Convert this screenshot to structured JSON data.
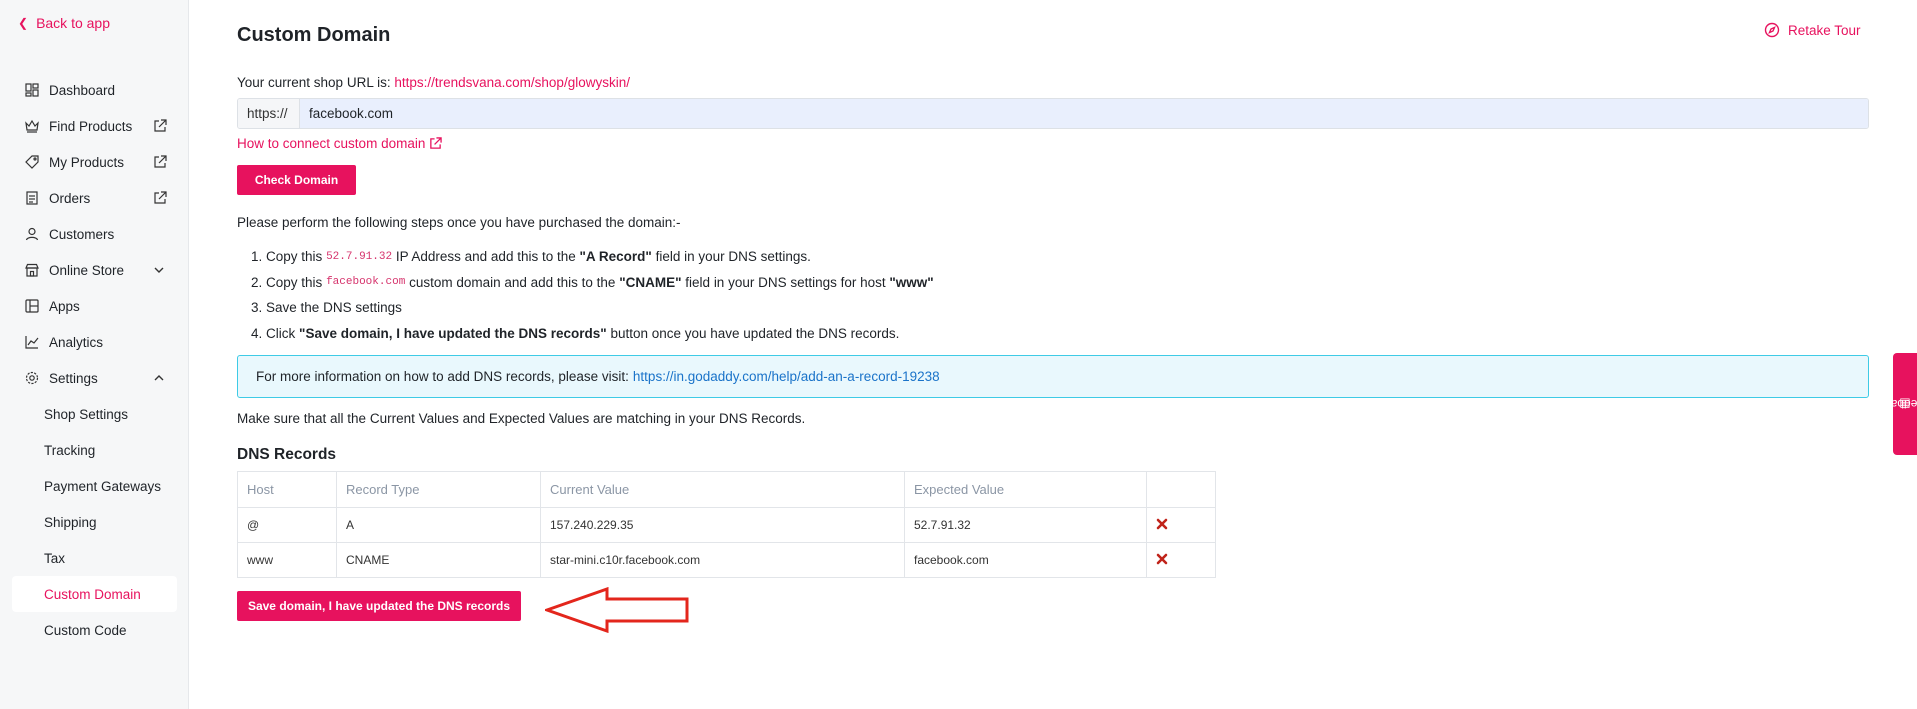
{
  "sidebar": {
    "back_label": "Back to app",
    "items": [
      {
        "label": "Dashboard",
        "icon": "dashboard-icon"
      },
      {
        "label": "Find Products",
        "icon": "crown-icon",
        "external": true
      },
      {
        "label": "My Products",
        "icon": "tag-icon",
        "external": true
      },
      {
        "label": "Orders",
        "icon": "document-icon",
        "external": true
      },
      {
        "label": "Customers",
        "icon": "user-icon"
      },
      {
        "label": "Online Store",
        "icon": "store-icon",
        "expandable": true
      },
      {
        "label": "Apps",
        "icon": "apps-icon"
      },
      {
        "label": "Analytics",
        "icon": "chart-icon"
      },
      {
        "label": "Settings",
        "icon": "gear-icon",
        "expanded": true
      }
    ],
    "settings_children": [
      "Shop Settings",
      "Tracking",
      "Payment Gateways",
      "Shipping",
      "Tax",
      "Custom Domain",
      "Custom Code"
    ],
    "active_child": "Custom Domain"
  },
  "header": {
    "title": "Custom Domain",
    "retake_tour": "Retake Tour"
  },
  "domain_form": {
    "shop_url_prefix": "Your current shop URL is:",
    "shop_url": "https://trendsvana.com/shop/glowyskin/",
    "scheme_prefix": "https://",
    "domain_value": "facebook.com",
    "how_to_link": "How to connect custom domain",
    "check_button": "Check Domain"
  },
  "steps": {
    "intro": "Please perform the following steps once you have purchased the domain:-",
    "step1": {
      "n": "1.",
      "a": "Copy this",
      "code": "52.7.91.32",
      "b": "IP Address and add this to the",
      "bold": "\"A Record\"",
      "c": "field in your DNS settings."
    },
    "step2": {
      "n": "2.",
      "a": "Copy this",
      "code": "facebook.com",
      "b": "custom domain and add this to the",
      "bold": "\"CNAME\"",
      "c": "field in your DNS settings for host",
      "bold2": "\"www\""
    },
    "step3": {
      "n": "3.",
      "a": "Save the DNS settings"
    },
    "step4": {
      "n": "4.",
      "a": "Click",
      "bold": "\"Save domain, I have updated the DNS records\"",
      "c": "button once you have updated the DNS records."
    }
  },
  "info": {
    "text": "For more information on how to add DNS records, please visit:",
    "link": "https://in.godaddy.com/help/add-an-a-record-19238"
  },
  "match_text": "Make sure that all the Current Values and Expected Values are matching in your DNS Records.",
  "dns": {
    "title": "DNS Records",
    "columns": [
      "Host",
      "Record Type",
      "Current Value",
      "Expected Value",
      ""
    ],
    "rows": [
      {
        "host": "@",
        "type": "A",
        "current": "157.240.229.35",
        "expected": "52.7.91.32",
        "status": "mismatch"
      },
      {
        "host": "www",
        "type": "CNAME",
        "current": "star-mini.c10r.facebook.com",
        "expected": "facebook.com",
        "status": "mismatch"
      }
    ]
  },
  "save_button": "Save domain, I have updated the DNS records",
  "feedback_label": "Feedback",
  "colors": {
    "accent": "#e7125e",
    "info_border": "#3ecbe6",
    "info_bg": "#e9f8fd",
    "link_blue": "#1a73c9",
    "error_red": "#c0231a"
  }
}
